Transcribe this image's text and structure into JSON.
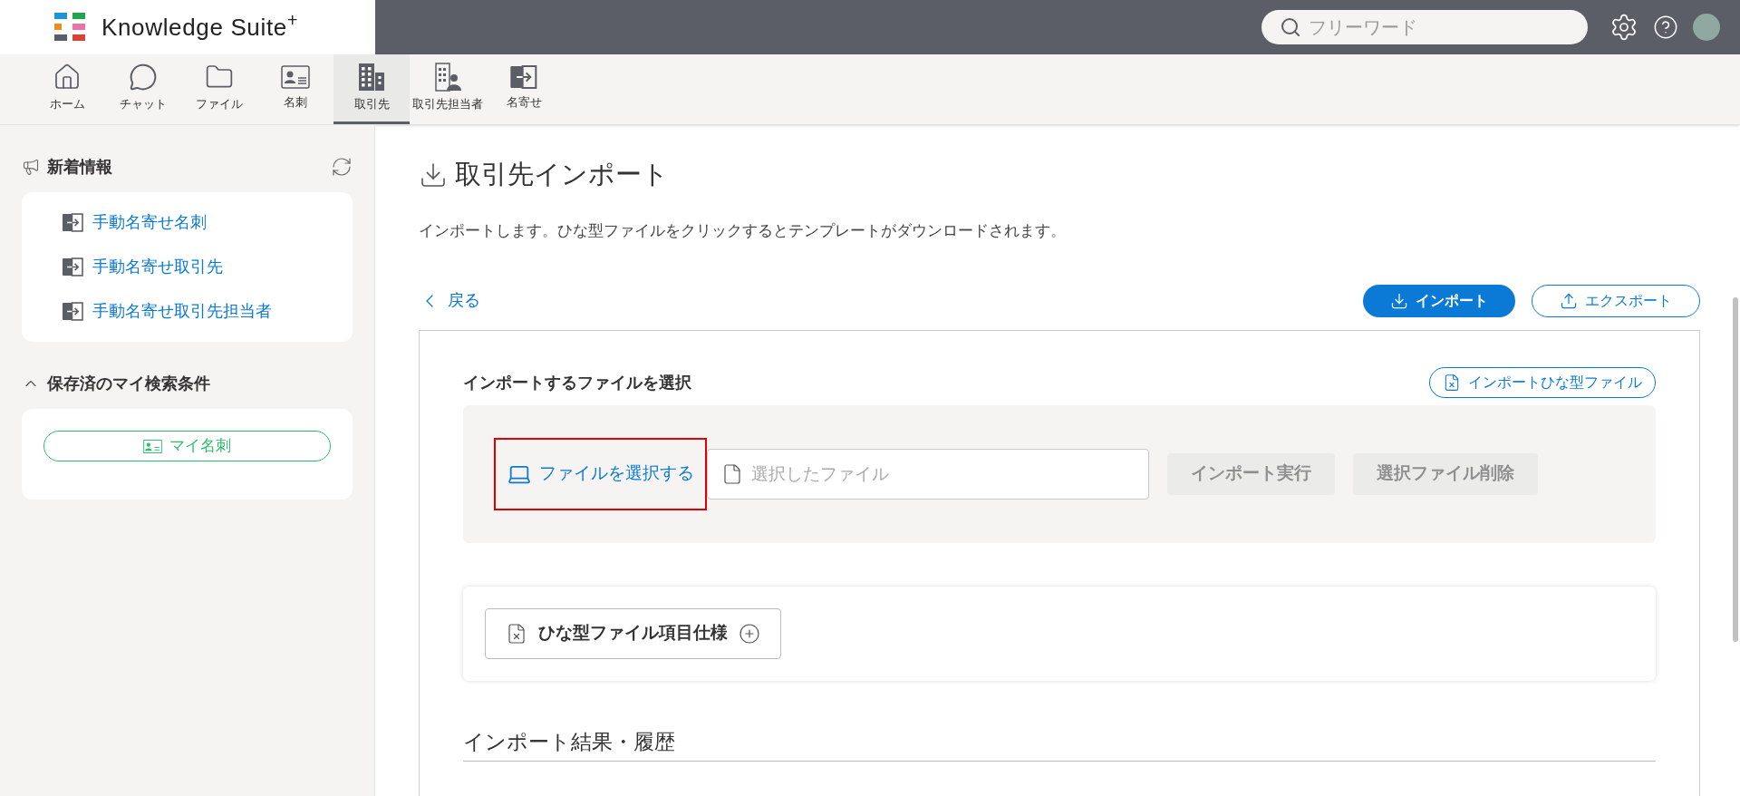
{
  "header": {
    "logo": "Knowledge Suite$^{+}$",
    "search": {
      "placeholder": "フリーワード"
    }
  },
  "nav": [
    {
      "kind": "home",
      "label": "ホーム",
      "selected": false
    },
    {
      "kind": "chat",
      "label": "チャット",
      "selected": false
    },
    {
      "kind": "file",
      "label": "ファイル",
      "selected": false
    },
    {
      "kind": "card",
      "label": "名刺",
      "selected": false
    },
    {
      "kind": "company",
      "label": "取引先",
      "selected": true
    },
    {
      "kind": "contact",
      "label": "取引先担当者",
      "selected": false
    },
    {
      "kind": "merge",
      "label": "名寄せ",
      "selected": false
    }
  ],
  "sidebar": {
    "news": {
      "title": "新着情報",
      "items": [
        "手動名寄せ名刺",
        "手動名寄せ取引先",
        "手動名寄せ取引先担当者"
      ]
    },
    "saved_searches": {
      "title": "保存済のマイ検索条件",
      "expanded": true,
      "items": [
        "マイ名刺"
      ]
    }
  },
  "main": {
    "title": "取引先インポート",
    "description": "インポートします。ひな型ファイルをクリックするとテンプレートがダウンロードされます。",
    "back": "戻る",
    "actions": [
      {
        "label": "インポート",
        "kind": "download",
        "selected": true
      },
      {
        "label": "エクスポート",
        "kind": "upload",
        "selected": false
      }
    ],
    "section_title": "インポートするファイルを選択",
    "template_button": "インポートひな型ファイル",
    "select_file": {
      "label": "ファイルを選択する",
      "highlighted": true
    },
    "file_field": {
      "placeholder": "選択したファイル"
    },
    "file_buttons": [
      {
        "label": "インポート実行",
        "disabled": true
      },
      {
        "label": "選択ファイル削除",
        "disabled": true
      }
    ],
    "spec_button": "ひな型ファイル項目仕様",
    "history_title": "インポート結果・履歴"
  }
}
